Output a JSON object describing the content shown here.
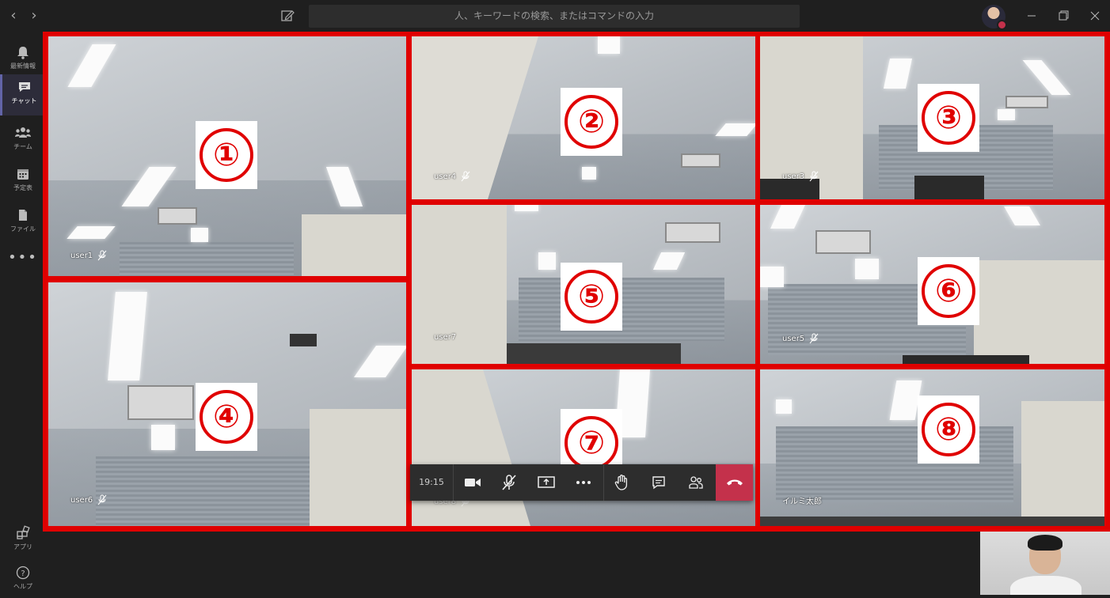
{
  "titlebar": {
    "search_placeholder": "人、キーワードの検索、またはコマンドの入力",
    "back_icon": "chevron-left-icon",
    "forward_icon": "chevron-right-icon",
    "compose_icon": "compose-icon"
  },
  "sidebar": {
    "items": [
      {
        "label": "最新情報",
        "icon": "bell-icon"
      },
      {
        "label": "チャット",
        "icon": "chat-icon"
      },
      {
        "label": "チーム",
        "icon": "teams-icon"
      },
      {
        "label": "予定表",
        "icon": "calendar-icon"
      },
      {
        "label": "ファイル",
        "icon": "file-icon"
      },
      {
        "label": "アプリ",
        "icon": "apps-icon"
      },
      {
        "label": "ヘルプ",
        "icon": "help-icon"
      }
    ],
    "more": "•••"
  },
  "tiles": [
    {
      "number": "①",
      "user": "user1"
    },
    {
      "number": "②",
      "user": "user4"
    },
    {
      "number": "③",
      "user": "user3"
    },
    {
      "number": "④",
      "user": "user6"
    },
    {
      "number": "⑤",
      "user": "user7"
    },
    {
      "number": "⑥",
      "user": "user5"
    },
    {
      "number": "⑦",
      "user": "user8"
    },
    {
      "number": "⑧",
      "user": "イルミ太郎"
    }
  ],
  "callbar": {
    "time": "19:15"
  },
  "colors": {
    "accent": "#6264a7",
    "highlight_border": "#e00000",
    "hangup": "#c4314b"
  }
}
